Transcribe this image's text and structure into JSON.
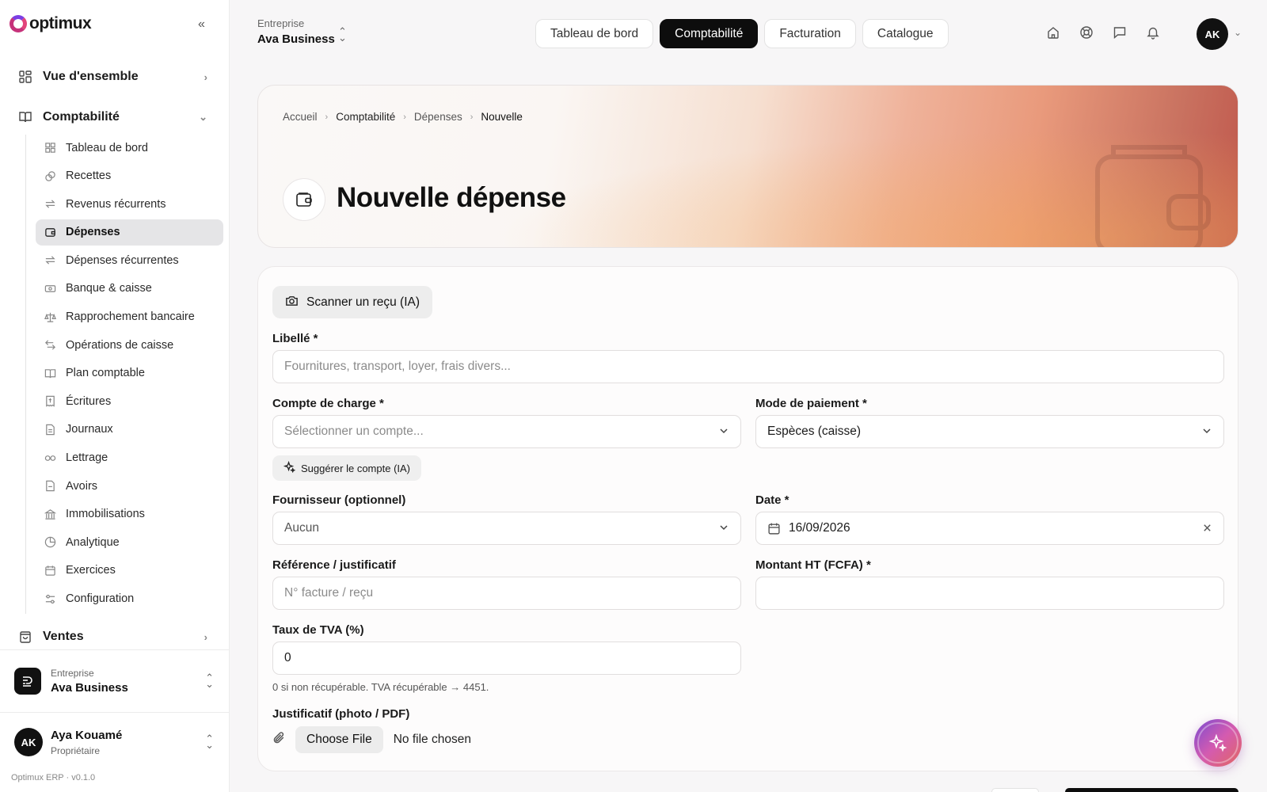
{
  "brand": {
    "name": "optimux"
  },
  "sidebar": {
    "overview_label": "Vue d'ensemble",
    "accounting_label": "Comptabilité",
    "sales_label": "Ventes",
    "items": [
      {
        "label": "Tableau de bord",
        "icon": "grid-icon"
      },
      {
        "label": "Recettes",
        "icon": "coins-icon"
      },
      {
        "label": "Revenus récurrents",
        "icon": "repeat-icon"
      },
      {
        "label": "Dépenses",
        "icon": "wallet-icon"
      },
      {
        "label": "Dépenses récurrentes",
        "icon": "repeat-icon"
      },
      {
        "label": "Banque & caisse",
        "icon": "banknote-icon"
      },
      {
        "label": "Rapprochement bancaire",
        "icon": "scale-icon"
      },
      {
        "label": "Opérations de caisse",
        "icon": "arrows-icon"
      },
      {
        "label": "Plan comptable",
        "icon": "book-icon"
      },
      {
        "label": "Écritures",
        "icon": "receipt-icon"
      },
      {
        "label": "Journaux",
        "icon": "file-icon"
      },
      {
        "label": "Lettrage",
        "icon": "link-icon"
      },
      {
        "label": "Avoirs",
        "icon": "file-icon"
      },
      {
        "label": "Immobilisations",
        "icon": "landmark-icon"
      },
      {
        "label": "Analytique",
        "icon": "pie-icon"
      },
      {
        "label": "Exercices",
        "icon": "calendar-icon"
      },
      {
        "label": "Configuration",
        "icon": "sliders-icon"
      }
    ],
    "active_item": "Dépenses",
    "org": {
      "caption": "Entreprise",
      "name": "Ava Business"
    },
    "user": {
      "initials": "AK",
      "name": "Aya Kouamé",
      "role": "Propriétaire"
    },
    "version": "Optimux ERP · v0.1.0"
  },
  "topbar": {
    "company_caption": "Entreprise",
    "company_name": "Ava Business",
    "tabs": [
      "Tableau de bord",
      "Comptabilité",
      "Facturation",
      "Catalogue"
    ],
    "active_tab": "Comptabilité",
    "icons": [
      "home-icon",
      "help-icon",
      "message-icon",
      "bell-icon"
    ],
    "user_initials": "AK"
  },
  "hero": {
    "breadcrumb": [
      "Accueil",
      "Comptabilité",
      "Dépenses",
      "Nouvelle"
    ],
    "title": "Nouvelle dépense"
  },
  "form": {
    "scan_label": "Scanner un reçu (IA)",
    "libelle_label": "Libellé *",
    "libelle_placeholder": "Fournitures, transport, loyer, frais divers...",
    "compte_label": "Compte de charge *",
    "compte_placeholder": "Sélectionner un compte...",
    "suggest_label": "Suggérer le compte (IA)",
    "mode_label": "Mode de paiement *",
    "mode_value": "Espèces (caisse)",
    "fournisseur_label": "Fournisseur (optionnel)",
    "fournisseur_value": "Aucun",
    "date_label": "Date *",
    "date_value": "16/09/2026",
    "reference_label": "Référence / justificatif",
    "reference_placeholder": "N° facture / reçu",
    "montant_label": "Montant HT (FCFA) *",
    "montant_value": "",
    "tva_label": "Taux de TVA (%)",
    "tva_value": "0",
    "tva_hint": "0 si non récupérable. TVA récupérable → 4451.",
    "justif_label": "Justificatif (photo / PDF)",
    "choose_file_label": "Choose File",
    "no_file_label": "No file chosen"
  },
  "colors": {
    "accent_dark": "#0d0d0d",
    "brand_pink": "#c6327a",
    "brand_purple": "#7b3fe4"
  }
}
